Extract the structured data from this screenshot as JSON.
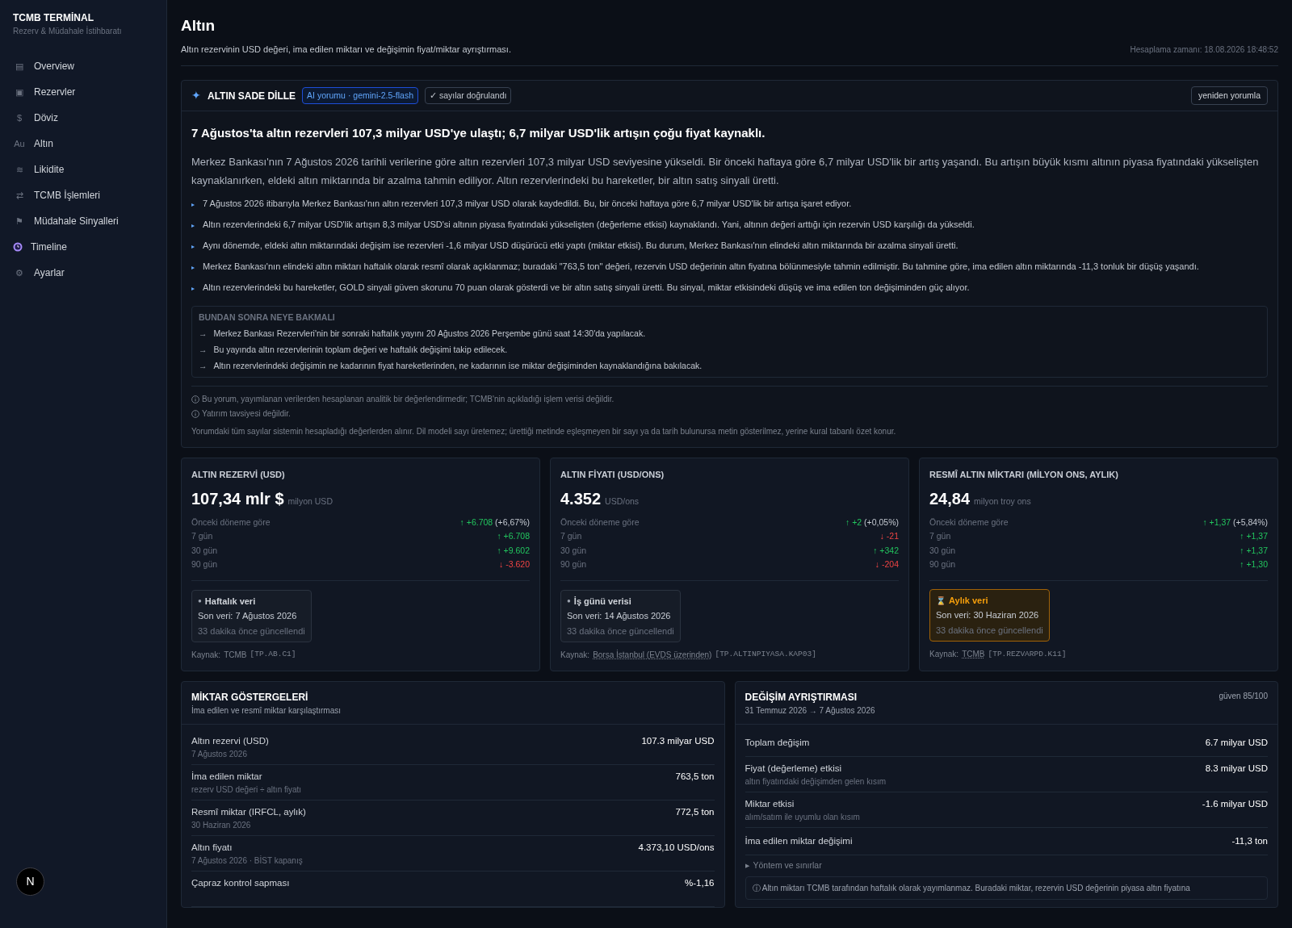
{
  "sidebar": {
    "title": "TCMB TERMİNAL",
    "subtitle": "Rezerv & Müdahale İstihbaratı",
    "items": [
      {
        "kind": "glyph",
        "icon": "▤",
        "label": "Overview"
      },
      {
        "kind": "glyph",
        "icon": "▣",
        "label": "Rezervler"
      },
      {
        "kind": "glyph",
        "icon": "$",
        "label": "Döviz"
      },
      {
        "kind": "glyph",
        "icon": "Au",
        "label": "Altın"
      },
      {
        "kind": "glyph",
        "icon": "≋",
        "label": "Likidite"
      },
      {
        "kind": "glyph",
        "icon": "⇄",
        "label": "TCMB İşlemleri"
      },
      {
        "kind": "glyph",
        "icon": "⚑",
        "label": "Müdahale Sinyalleri"
      },
      {
        "kind": "clock",
        "label": "Timeline"
      },
      {
        "kind": "glyph",
        "icon": "⚙",
        "label": "Ayarlar"
      }
    ],
    "dev_badge": "N"
  },
  "header": {
    "title": "Altın",
    "subtitle": "Altın rezervinin USD değeri, ima edilen miktarı ve değişimin fiyat/miktar ayrıştırması.",
    "timestamp": "Hesaplama zamanı: 18.08.2026 18:48:52"
  },
  "ai_panel": {
    "icon": "✦",
    "title": "ALTIN SADE DİLLE",
    "model_tag": "AI yorumu · gemini-2.5-flash",
    "verified_tag": "✓ sayılar doğrulandı",
    "regenerate": "yeniden yorumla",
    "headline": "7 Ağustos'ta altın rezervleri 107,3 milyar USD'ye ulaştı; 6,7 milyar USD'lik artışın çoğu fiyat kaynaklı.",
    "summary": "Merkez Bankası'nın 7 Ağustos 2026 tarihli verilerine göre altın rezervleri 107,3 milyar USD seviyesine yükseldi. Bir önceki haftaya göre 6,7 milyar USD'lik bir artış yaşandı. Bu artışın büyük kısmı altının piyasa fiyatındaki yükselişten kaynaklanırken, eldeki altın miktarında bir azalma tahmin ediliyor. Altın rezervlerindeki bu hareketler, bir altın satış sinyali üretti.",
    "bullet_icon": "▸",
    "bullets": [
      "7 Ağustos 2026 itibarıyla Merkez Bankası'nın altın rezervleri 107,3 milyar USD olarak kaydedildi. Bu, bir önceki haftaya göre 6,7 milyar USD'lik bir artışa işaret ediyor.",
      "Altın rezervlerindeki 6,7 milyar USD'lik artışın 8,3 milyar USD'si altının piyasa fiyatındaki yükselişten (değerleme etkisi) kaynaklandı. Yani, altının değeri arttığı için rezervin USD karşılığı da yükseldi.",
      "Aynı dönemde, eldeki altın miktarındaki değişim ise rezervleri -1,6 milyar USD düşürücü etki yaptı (miktar etkisi). Bu durum, Merkez Bankası'nın elindeki altın miktarında bir azalma sinyali üretti.",
      "Merkez Bankası'nın elindeki altın miktarı haftalık olarak resmî olarak açıklanmaz; buradaki \"763,5 ton\" değeri, rezervin USD değerinin altın fiyatına bölünmesiyle tahmin edilmiştir. Bu tahmine göre, ima edilen altın miktarında -11,3 tonluk bir düşüş yaşandı.",
      "Altın rezervlerindeki bu hareketler, GOLD sinyali güven skorunu 70 puan olarak gösterdi ve bir altın satış sinyali üretti. Bu sinyal, miktar etkisindeki düşüş ve ima edilen ton değişiminden güç alıyor."
    ],
    "next": {
      "title": "BUNDAN SONRA NEYE BAKMALI",
      "arrow": "→",
      "items": [
        "Merkez Bankası Rezervleri'nin bir sonraki haftalık yayını 20 Ağustos 2026 Perşembe günü saat 14:30'da yapılacak.",
        "Bu yayında altın rezervlerinin toplam değeri ve haftalık değişimi takip edilecek.",
        "Altın rezervlerindeki değişimin ne kadarının fiyat hareketlerinden, ne kadarının ise miktar değişiminden kaynaklandığına bakılacak."
      ]
    },
    "disclaimers": [
      "Bu yorum, yayımlanan verilerden hesaplanan analitik bir değerlendirmedir; TCMB'nin açıkladığı işlem verisi değildir.",
      "Yatırım tavsiyesi değildir."
    ],
    "footnote": "Yorumdaki tüm sayılar sistemin hesapladığı değerlerden alınır. Dil modeli sayı üretemez; ürettiği metinde eşleşmeyen bir sayı ya da tarih bulunursa metin gösterilmez, yerine kural tabanlı özet konur."
  },
  "metric_cards": [
    {
      "title": "ALTIN REZERVİ (USD)",
      "value": "107,34 mlr $",
      "unit": "milyon USD",
      "rows": [
        {
          "label": "Önceki döneme göre",
          "rising": true,
          "delta": "↑ +6.708",
          "pct": "(+6,67%)"
        },
        {
          "label": "7 gün",
          "rising": true,
          "delta": "↑ +6.708"
        },
        {
          "label": "30 gün",
          "rising": true,
          "delta": "↑ +9.602"
        },
        {
          "label": "90 gün",
          "rising": false,
          "delta": "↓ -3.620"
        }
      ],
      "badge": {
        "warning": false,
        "icon": "●",
        "title": "Haftalık veri",
        "last": "Son veri: 7 Ağustos 2026",
        "updated": "33 dakika önce güncellendi"
      },
      "source": {
        "label": "Kaynak:",
        "name": "TCMB",
        "linked": false,
        "code": "[TP.AB.C1]"
      }
    },
    {
      "title": "ALTIN FİYATI (USD/ONS)",
      "value": "4.352",
      "unit": "USD/ons",
      "rows": [
        {
          "label": "Önceki döneme göre",
          "rising": true,
          "delta": "↑ +2",
          "pct": "(+0,05%)"
        },
        {
          "label": "7 gün",
          "rising": false,
          "delta": "↓ -21"
        },
        {
          "label": "30 gün",
          "rising": true,
          "delta": "↑ +342"
        },
        {
          "label": "90 gün",
          "rising": false,
          "delta": "↓ -204"
        }
      ],
      "badge": {
        "warning": false,
        "icon": "●",
        "title": "İş günü verisi",
        "last": "Son veri: 14 Ağustos 2026",
        "updated": "33 dakika önce güncellendi"
      },
      "source": {
        "label": "Kaynak:",
        "name": "Borsa İstanbul (EVDS üzerinden)",
        "linked": true,
        "code": "[TP.ALTINPIYASA.KAP03]"
      }
    },
    {
      "title": "RESMÎ ALTIN MİKTARI (MİLYON ONS, AYLIK)",
      "value": "24,84",
      "unit": "milyon troy ons",
      "rows": [
        {
          "label": "Önceki döneme göre",
          "rising": true,
          "delta": "↑ +1,37",
          "pct": "(+5,84%)"
        },
        {
          "label": "7 gün",
          "rising": true,
          "delta": "↑ +1,37"
        },
        {
          "label": "30 gün",
          "rising": true,
          "delta": "↑ +1,37"
        },
        {
          "label": "90 gün",
          "rising": true,
          "delta": "↑ +1,30"
        }
      ],
      "badge": {
        "warning": true,
        "icon": "⌛",
        "title": "Aylık veri",
        "last": "Son veri: 30 Haziran 2026",
        "updated": "33 dakika önce güncellendi"
      },
      "source": {
        "label": "Kaynak:",
        "name": "TCMB",
        "linked": true,
        "code": "[TP.REZVARPD.K11]"
      }
    }
  ],
  "quantity_panel": {
    "title": "MİKTAR GÖSTERGELERİ",
    "subtitle": "İma edilen ve resmî miktar karşılaştırması",
    "rows": [
      {
        "label": "Altın rezervi (USD)",
        "note": "7 Ağustos 2026",
        "value": "107.3 milyar USD"
      },
      {
        "label": "İma edilen miktar",
        "note": "rezerv USD değeri ÷ altın fiyatı",
        "value": "763,5 ton"
      },
      {
        "label": "Resmî miktar (IRFCL, aylık)",
        "note": "30 Haziran 2026",
        "value": "772,5 ton"
      },
      {
        "label": "Altın fiyatı",
        "note": "7 Ağustos 2026 · BİST kapanış",
        "value": "4.373,10 USD/ons"
      },
      {
        "label": "Çapraz kontrol sapması",
        "value": "%-1,16"
      }
    ]
  },
  "decomposition_panel": {
    "title": "DEĞİŞİM AYRIŞTIRMASI",
    "period": "31 Temmuz 2026 → 7 Ağustos 2026",
    "confidence": "güven 85/100",
    "rows": [
      {
        "label": "Toplam değişim",
        "value": "6.7 milyar USD"
      },
      {
        "label": "Fiyat (değerleme) etkisi",
        "note": "altın fiyatındaki değişimden gelen kısım",
        "value": "8.3 milyar USD"
      },
      {
        "label": "Miktar etkisi",
        "note": "alım/satım ile uyumlu olan kısım",
        "value": "-1.6 milyar USD"
      },
      {
        "label": "İma edilen miktar değişimi",
        "value": "-11,3 ton"
      }
    ],
    "method": {
      "marker": "▶",
      "label": "Yöntem ve sınırlar",
      "expanded": false
    },
    "info": "ⓘ Altın miktarı TCMB tarafından haftalık olarak yayımlanmaz. Buradaki miktar, rezervin USD değerinin piyasa altın fiyatına"
  }
}
